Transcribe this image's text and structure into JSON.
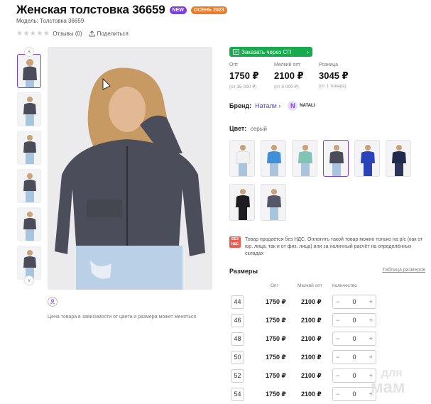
{
  "product": {
    "title": "Женская толстовка 36659",
    "badge_new": "NEW",
    "badge_season": "ОСЕНЬ 2023",
    "model": "Модель: Толстовка  36659",
    "reviews": "Отзывы (0)",
    "share": "Поделиться"
  },
  "order_button": {
    "label": "Заказать через СП"
  },
  "prices": [
    {
      "label": "Опт",
      "value": "1750 ₽",
      "note": "(от 35 000 ₽)"
    },
    {
      "label": "Мелкий опт",
      "value": "2100 ₽",
      "note": "(от 5 000 ₽)"
    },
    {
      "label": "Розница",
      "value": "3045 ₽",
      "note": "(от 1 товара)"
    }
  ],
  "brand": {
    "label": "Бренд:",
    "name": "Натали",
    "logo_text": "NATALI"
  },
  "color": {
    "label": "Цвет:",
    "value": "серый"
  },
  "vat": {
    "icon": "БЕЗ НДС",
    "text": "Товар продается без НДС. Оплатить такой товар можно только на р/с (как от юр. лица, так и от физ. лица) или за наличный расчёт на определённых складах"
  },
  "sizes": {
    "title": "Размеры",
    "table_link": "Таблица размеров",
    "col_opt": "Опт",
    "col_small": "Мелкий опт",
    "col_qty": "Количество",
    "rows": [
      {
        "size": "44",
        "opt": "1750 ₽",
        "small": "2100 ₽",
        "qty": "0"
      },
      {
        "size": "46",
        "opt": "1750 ₽",
        "small": "2100 ₽",
        "qty": "0"
      },
      {
        "size": "48",
        "opt": "1750 ₽",
        "small": "2100 ₽",
        "qty": "0"
      },
      {
        "size": "50",
        "opt": "1750 ₽",
        "small": "2100 ₽",
        "qty": "0"
      },
      {
        "size": "52",
        "opt": "1750 ₽",
        "small": "2100 ₽",
        "qty": "0"
      },
      {
        "size": "54",
        "opt": "1750 ₽",
        "small": "2100 ₽",
        "qty": "0"
      }
    ]
  },
  "price_note": "Цена товара в зависимости от цвета и размера может меняться",
  "watermark": {
    "line1": "для",
    "line2": "мам"
  },
  "colors": {
    "accent": "#7b3fe4",
    "green": "#19a94e",
    "orange": "#f07a2a"
  }
}
